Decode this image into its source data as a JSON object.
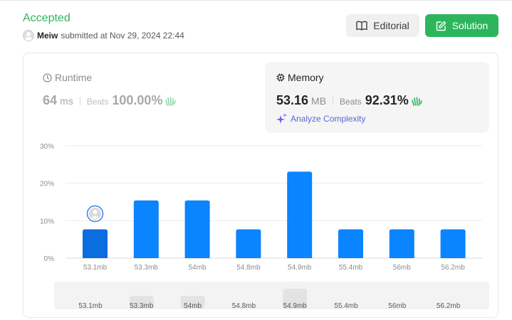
{
  "header": {
    "status": "Accepted",
    "username": "Meiw",
    "submitted_text": "submitted at Nov 29, 2024 22:44",
    "editorial_label": "Editorial",
    "solution_label": "Solution"
  },
  "runtime": {
    "title": "Runtime",
    "value": "64",
    "unit": "ms",
    "beats_label": "Beats",
    "beats_value": "100.00%"
  },
  "memory": {
    "title": "Memory",
    "value": "53.16",
    "unit": "MB",
    "beats_label": "Beats",
    "beats_value": "92.31%",
    "analyze_label": "Analyze Complexity"
  },
  "colors": {
    "accepted": "#2db55d",
    "bar": "#0a84ff",
    "bar_highlight": "#0a6de0",
    "accent_link": "#5a67d8"
  },
  "icons": {
    "editorial": "book-open-icon",
    "solution": "edit-icon",
    "runtime": "clock-icon",
    "memory": "chip-icon",
    "beats": "clap-hands-icon",
    "analyze": "sparkles-icon"
  },
  "chart_data": {
    "type": "bar",
    "categories": [
      "53.1mb",
      "53.3mb",
      "54mb",
      "54.8mb",
      "54.9mb",
      "55.4mb",
      "56mb",
      "56.2mb"
    ],
    "values": [
      7.7,
      15.4,
      15.4,
      7.7,
      23.1,
      7.7,
      7.7,
      7.7
    ],
    "ylim": [
      0,
      30
    ],
    "yticks": [
      "0%",
      "10%",
      "20%",
      "30%"
    ],
    "highlight_index": 0,
    "grid": true,
    "navigator": {
      "labels": [
        "53.1mb",
        "53.3mb",
        "54mb",
        "54.8mb",
        "54.9mb",
        "55.4mb",
        "56mb",
        "56.2mb"
      ]
    }
  }
}
